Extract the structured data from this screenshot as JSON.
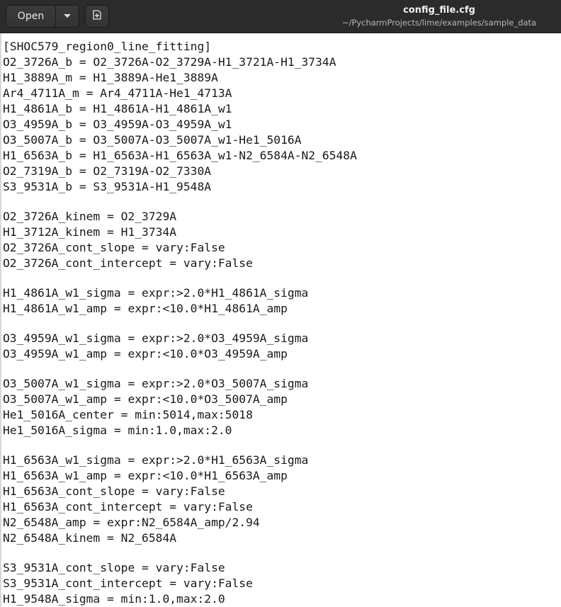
{
  "toolbar": {
    "open_label": "Open",
    "menu_icon": "chevron-down-icon",
    "new_tab_icon": "new-document-icon"
  },
  "window": {
    "title": "config_file.cfg",
    "subtitle": "~/PycharmProjects/lime/examples/sample_data"
  },
  "editor": {
    "lines": [
      "[SHOC579_region0_line_fitting]",
      "O2_3726A_b = O2_3726A-O2_3729A-H1_3721A-H1_3734A",
      "H1_3889A_m = H1_3889A-He1_3889A",
      "Ar4_4711A_m = Ar4_4711A-He1_4713A",
      "H1_4861A_b = H1_4861A-H1_4861A_w1",
      "O3_4959A_b = O3_4959A-O3_4959A_w1",
      "O3_5007A_b = O3_5007A-O3_5007A_w1-He1_5016A",
      "H1_6563A_b = H1_6563A-H1_6563A_w1-N2_6584A-N2_6548A",
      "O2_7319A_b = O2_7319A-O2_7330A",
      "S3_9531A_b = S3_9531A-H1_9548A",
      "",
      "O2_3726A_kinem = O2_3729A",
      "H1_3712A_kinem = H1_3734A",
      "O2_3726A_cont_slope = vary:False",
      "O2_3726A_cont_intercept = vary:False",
      "",
      "H1_4861A_w1_sigma = expr:>2.0*H1_4861A_sigma",
      "H1_4861A_w1_amp = expr:<10.0*H1_4861A_amp",
      "",
      "O3_4959A_w1_sigma = expr:>2.0*O3_4959A_sigma",
      "O3_4959A_w1_amp = expr:<10.0*O3_4959A_amp",
      "",
      "O3_5007A_w1_sigma = expr:>2.0*O3_5007A_sigma",
      "O3_5007A_w1_amp = expr:<10.0*O3_5007A_amp",
      "He1_5016A_center = min:5014,max:5018",
      "He1_5016A_sigma = min:1.0,max:2.0",
      "",
      "H1_6563A_w1_sigma = expr:>2.0*H1_6563A_sigma",
      "H1_6563A_w1_amp = expr:<10.0*H1_6563A_amp",
      "H1_6563A_cont_slope = vary:False",
      "H1_6563A_cont_intercept = vary:False",
      "N2_6548A_amp = expr:N2_6584A_amp/2.94",
      "N2_6548A_kinem = N2_6584A",
      "",
      "S3_9531A_cont_slope = vary:False",
      "S3_9531A_cont_intercept = vary:False",
      "H1_9548A_sigma = min:1.0,max:2.0"
    ]
  }
}
